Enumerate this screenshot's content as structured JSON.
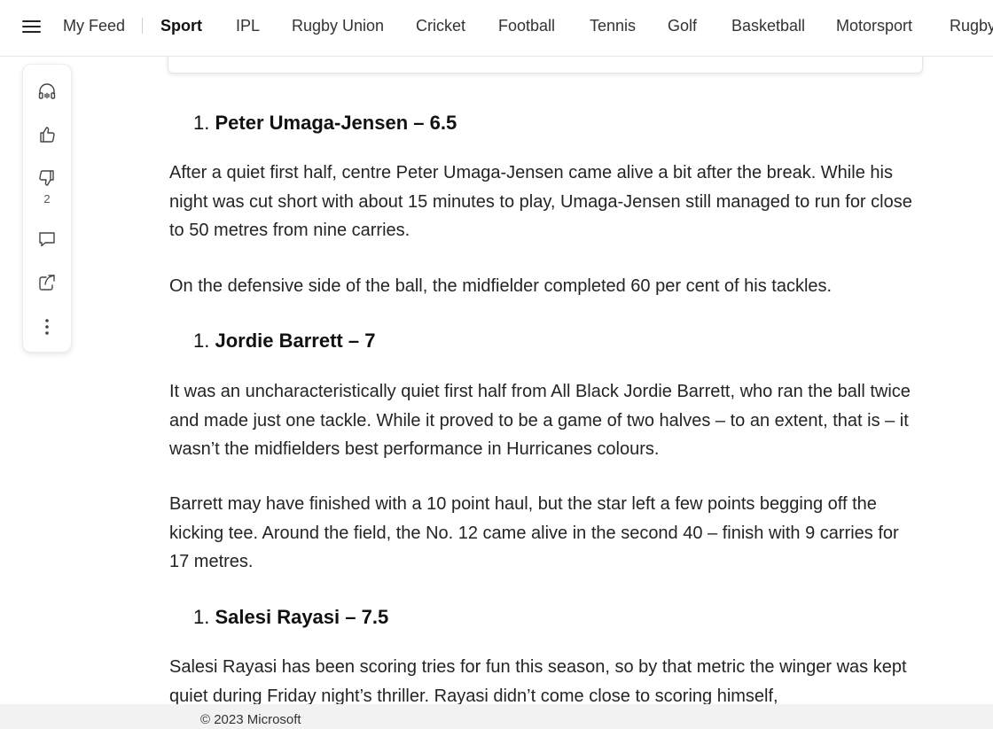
{
  "nav": {
    "items": [
      {
        "label": "My Feed",
        "active": false
      },
      {
        "label": "Sport",
        "active": true
      },
      {
        "label": "IPL",
        "active": false
      },
      {
        "label": "Rugby Union",
        "active": false
      },
      {
        "label": "Cricket",
        "active": false
      },
      {
        "label": "Football",
        "active": false
      },
      {
        "label": "Tennis",
        "active": false
      },
      {
        "label": "Golf",
        "active": false
      },
      {
        "label": "Basketball",
        "active": false
      },
      {
        "label": "Motorsport",
        "active": false
      },
      {
        "label": "Rugby",
        "active": false
      }
    ]
  },
  "rail": {
    "dislike_count": "2",
    "icons": [
      "headphones-icon",
      "thumbs-up-icon",
      "thumbs-down-icon",
      "comment-icon",
      "share-icon",
      "more-icon"
    ]
  },
  "article": {
    "h1_num": "1.",
    "h1_title": "Peter Umaga-Jensen – 6.5",
    "p1": "After a quiet first half, centre Peter Umaga-Jensen came alive a bit after the break. While his night was cut short with about 15 minutes to play, Umaga-Jensen still managed to run for close to 50 metres from nine carries.",
    "p2": "On the defensive side of the ball, the midfielder completed 60 per cent of his tackles.",
    "h2_num": "1.",
    "h2_title": "Jordie Barrett – 7",
    "p3": "It was an uncharacteristically quiet first half from All Black Jordie Barrett, who ran the ball twice and made just one tackle. While it proved to be a game of two halves – to an extent, that is – it wasn’t the midfielders best performance in Hurricanes colours.",
    "p4": "Barrett may have finished with a 10 point haul, but the star left a few points begging off the kicking tee. Around the field, the No. 12 came alive in the second 40 – finish with 9 carries for 17 metres.",
    "h3_num": "1.",
    "h3_title": "Salesi Rayasi – 7.5",
    "p5": "Salesi Rayasi has been scoring tries for fun this season, so by that metric the winger was kept quiet during Friday night’s thriller. Rayasi didn’t come close to scoring himself,"
  },
  "footer": {
    "copyright": "© 2023 Microsoft"
  }
}
